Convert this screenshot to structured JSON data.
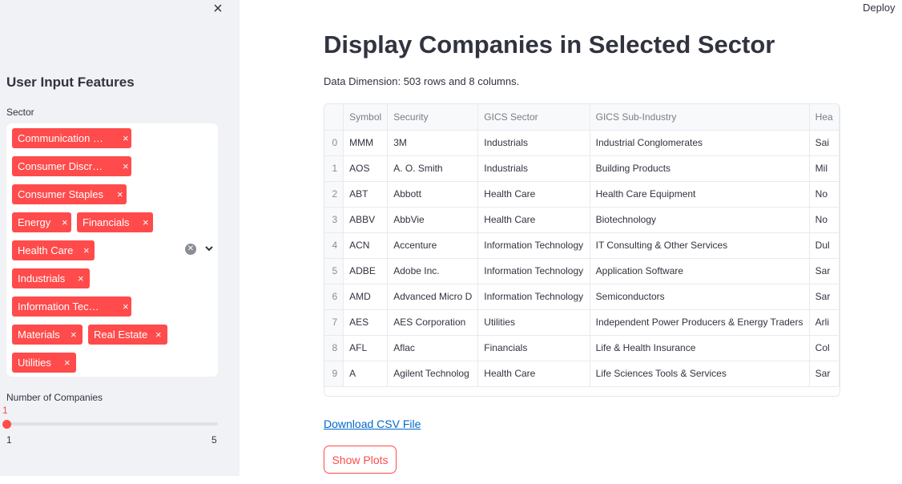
{
  "header": {
    "deploy_label": "Deploy"
  },
  "sidebar": {
    "close_label": "×",
    "title": "User Input Features",
    "sector_label": "Sector",
    "sector_tags": [
      "Communication …",
      "Consumer Discr…",
      "Consumer Staples",
      "Energy",
      "Financials",
      "Health Care",
      "Industrials",
      "Information Tec…",
      "Materials",
      "Real Estate",
      "Utilities"
    ],
    "tag_remove_glyph": "×",
    "num_companies_label": "Number of Companies",
    "slider": {
      "value": "1",
      "min": "1",
      "max": "5"
    },
    "accent_color": "#ff4b4b"
  },
  "main": {
    "title": "Display Companies in Selected Sector",
    "dimension_text": "Data Dimension: 503 rows and 8 columns.",
    "download_link": "Download CSV File",
    "show_plots_button": "Show Plots"
  },
  "table": {
    "columns": [
      "",
      "Symbol",
      "Security",
      "GICS Sector",
      "GICS Sub-Industry",
      "Hea"
    ],
    "rows": [
      [
        "0",
        "MMM",
        "3M",
        "Industrials",
        "Industrial Conglomerates",
        "Sai"
      ],
      [
        "1",
        "AOS",
        "A. O. Smith",
        "Industrials",
        "Building Products",
        "Mil"
      ],
      [
        "2",
        "ABT",
        "Abbott",
        "Health Care",
        "Health Care Equipment",
        "No"
      ],
      [
        "3",
        "ABBV",
        "AbbVie",
        "Health Care",
        "Biotechnology",
        "No"
      ],
      [
        "4",
        "ACN",
        "Accenture",
        "Information Technology",
        "IT Consulting & Other Services",
        "Dul"
      ],
      [
        "5",
        "ADBE",
        "Adobe Inc.",
        "Information Technology",
        "Application Software",
        "Sar"
      ],
      [
        "6",
        "AMD",
        "Advanced Micro D",
        "Information Technology",
        "Semiconductors",
        "Sar"
      ],
      [
        "7",
        "AES",
        "AES Corporation",
        "Utilities",
        "Independent Power Producers & Energy Traders",
        "Arli"
      ],
      [
        "8",
        "AFL",
        "Aflac",
        "Financials",
        "Life & Health Insurance",
        "Col"
      ],
      [
        "9",
        "A",
        "Agilent Technolog",
        "Health Care",
        "Life Sciences Tools & Services",
        "Sar"
      ]
    ]
  }
}
